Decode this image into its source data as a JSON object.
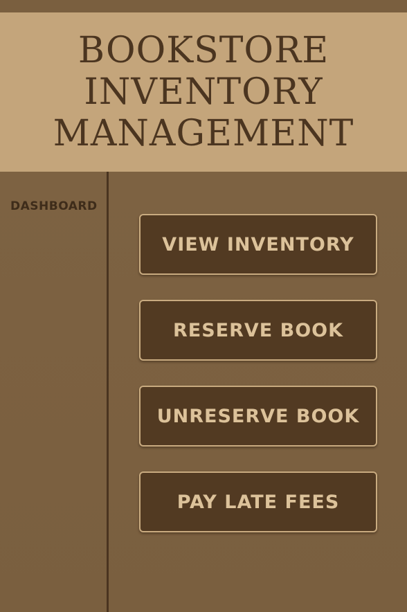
{
  "header": {
    "title_lines": [
      "BOOKSTORE",
      "INVENTORY",
      "MANAGEMENT"
    ]
  },
  "sidebar": {
    "title": "DASHBOARD"
  },
  "actions": [
    {
      "label": "VIEW INVENTORY"
    },
    {
      "label": "RESERVE BOOK"
    },
    {
      "label": "UNRESERVE BOOK"
    },
    {
      "label": "PAY LATE FEES"
    }
  ],
  "colors": {
    "header_bg": "#c4a57b",
    "body_bg": "#7b6040",
    "button_bg": "#523a22",
    "button_text": "#dcc29a",
    "title_text": "#4b3520"
  }
}
